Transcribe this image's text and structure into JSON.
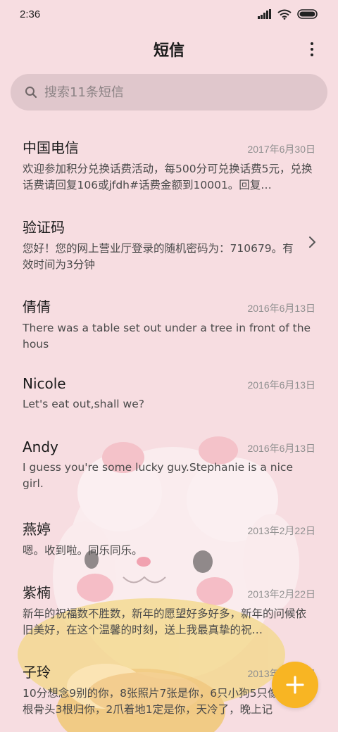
{
  "status_bar": {
    "time": "2:36"
  },
  "header": {
    "title": "短信"
  },
  "search": {
    "placeholder": "搜索11条短信"
  },
  "conversations": [
    {
      "name": "中国电信",
      "date": "2017年6月30日",
      "preview": "欢迎参加积分兑换话费活动，每500分可兑换话费5元，兑换话费请回复106或jfdh#话费金额到10001。回复…"
    },
    {
      "name": "验证码",
      "date": "",
      "preview": "您好！您的网上营业厅登录的随机密码为：710679。有效时间为3分钟"
    },
    {
      "name": "倩倩",
      "date": "2016年6月13日",
      "preview": "There was a table set out under a tree in front of the hous"
    },
    {
      "name": "Nicole",
      "date": "2016年6月13日",
      "preview": "Let's eat out,shall we?"
    },
    {
      "name": "Andy",
      "date": "2016年6月13日",
      "preview": "I guess you're some lucky guy.Stephanie is a nice girl."
    },
    {
      "name": "燕婷",
      "date": "2013年2月22日",
      "preview": "嗯。收到啦。同乐同乐。"
    },
    {
      "name": "紫楠",
      "date": "2013年2月22日",
      "preview": "新年的祝福数不胜数，新年的愿望好多好多，新年的问候依旧美好，在这个温馨的时刻，送上我最真挚的祝…"
    },
    {
      "name": "子玲",
      "date": "2013年2月22日",
      "preview": "10分想念9别的你，8张照片7张是你，6只小狗5只像你，4根骨头3根归你，2爪着地1定是你，天冷了，晚上记"
    }
  ],
  "colors": {
    "background": "#f7dde1",
    "fab": "#f8b523",
    "search_bg": "#dcc3c8"
  },
  "icons": {
    "search": "search-icon",
    "more": "more-vert-icon",
    "chevron": "chevron-right-icon",
    "fab": "plus-icon"
  }
}
